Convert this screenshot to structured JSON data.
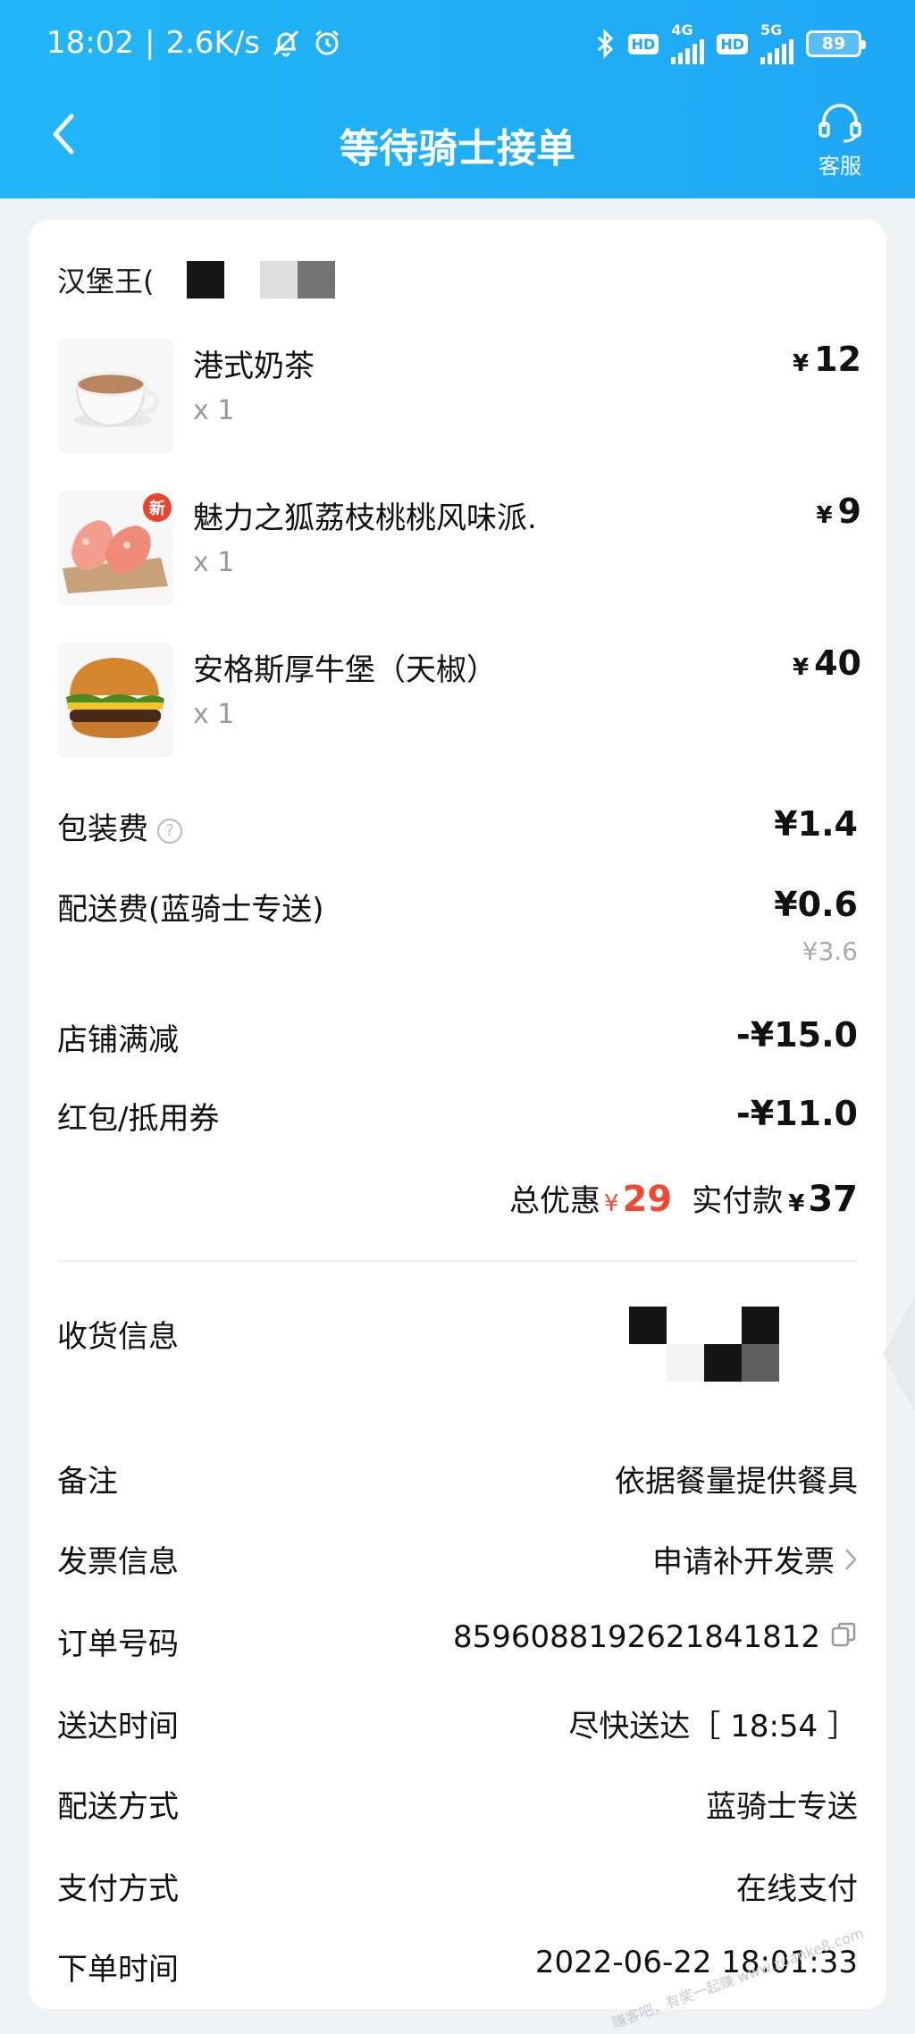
{
  "status_bar": {
    "time": "18:02",
    "net_speed": "2.6K/s",
    "separator": "|",
    "hd1": "HD",
    "net1": "4G",
    "hd2": "HD",
    "net2": "5G",
    "battery": "89"
  },
  "nav": {
    "title": "等待骑士接单",
    "service_label": "客服"
  },
  "store": {
    "name": "汉堡王("
  },
  "items": [
    {
      "name": "港式奶茶",
      "qty": "x 1",
      "yen": "¥",
      "price": "12",
      "badge": ""
    },
    {
      "name": "魅力之狐荔枝桃桃风味派.",
      "qty": "x 1",
      "yen": "¥",
      "price": "9",
      "badge": "新"
    },
    {
      "name": "安格斯厚牛堡（天椒）",
      "qty": "x 1",
      "yen": "¥",
      "price": "40",
      "badge": ""
    }
  ],
  "fees": {
    "packaging_label": "包装费",
    "packaging_value": "¥1.4",
    "delivery_label": "配送费(蓝骑士专送)",
    "delivery_value": "¥0.6",
    "delivery_original": "¥3.6",
    "store_discount_label": "店铺满减",
    "store_discount_value": "-¥15.0",
    "coupon_label": "红包/抵用券",
    "coupon_value": "-¥11.0"
  },
  "summary": {
    "total_discount_label": "总优惠",
    "total_discount_yen": "¥",
    "total_discount_value": "29",
    "paid_label": "实付款",
    "paid_yen": "¥",
    "paid_value": "37"
  },
  "info": {
    "receiver_label": "收货信息",
    "remark_label": "备注",
    "remark_value": "依据餐量提供餐具",
    "invoice_label": "发票信息",
    "invoice_value": "申请补开发票",
    "order_no_label": "订单号码",
    "order_no_value": "8596088192621841812",
    "delivery_time_label": "送达时间",
    "delivery_time_value": "尽快送达［ 18:54 ］",
    "delivery_method_label": "配送方式",
    "delivery_method_value": "蓝骑士专送",
    "payment_label": "支付方式",
    "payment_value": "在线支付",
    "order_time_label": "下单时间",
    "order_time_value": "2022-06-22 18:01:33"
  },
  "watermark": "赚客吧，有奖一起赚 www.zuanke8.com",
  "colors": {
    "header_blue": "#1fa7f4",
    "discount_red": "#f0492f",
    "muted_gray": "#999999"
  }
}
